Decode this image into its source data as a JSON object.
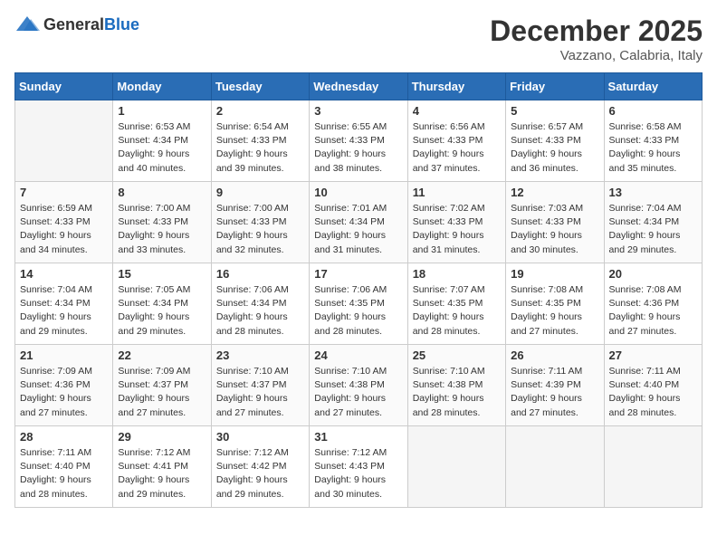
{
  "header": {
    "logo_general": "General",
    "logo_blue": "Blue",
    "month": "December 2025",
    "location": "Vazzano, Calabria, Italy"
  },
  "days_of_week": [
    "Sunday",
    "Monday",
    "Tuesday",
    "Wednesday",
    "Thursday",
    "Friday",
    "Saturday"
  ],
  "weeks": [
    [
      {
        "day": "",
        "empty": true
      },
      {
        "day": "1",
        "sunrise": "6:53 AM",
        "sunset": "4:34 PM",
        "daylight": "9 hours and 40 minutes."
      },
      {
        "day": "2",
        "sunrise": "6:54 AM",
        "sunset": "4:33 PM",
        "daylight": "9 hours and 39 minutes."
      },
      {
        "day": "3",
        "sunrise": "6:55 AM",
        "sunset": "4:33 PM",
        "daylight": "9 hours and 38 minutes."
      },
      {
        "day": "4",
        "sunrise": "6:56 AM",
        "sunset": "4:33 PM",
        "daylight": "9 hours and 37 minutes."
      },
      {
        "day": "5",
        "sunrise": "6:57 AM",
        "sunset": "4:33 PM",
        "daylight": "9 hours and 36 minutes."
      },
      {
        "day": "6",
        "sunrise": "6:58 AM",
        "sunset": "4:33 PM",
        "daylight": "9 hours and 35 minutes."
      }
    ],
    [
      {
        "day": "7",
        "sunrise": "6:59 AM",
        "sunset": "4:33 PM",
        "daylight": "9 hours and 34 minutes."
      },
      {
        "day": "8",
        "sunrise": "7:00 AM",
        "sunset": "4:33 PM",
        "daylight": "9 hours and 33 minutes."
      },
      {
        "day": "9",
        "sunrise": "7:00 AM",
        "sunset": "4:33 PM",
        "daylight": "9 hours and 32 minutes."
      },
      {
        "day": "10",
        "sunrise": "7:01 AM",
        "sunset": "4:34 PM",
        "daylight": "9 hours and 31 minutes."
      },
      {
        "day": "11",
        "sunrise": "7:02 AM",
        "sunset": "4:33 PM",
        "daylight": "9 hours and 31 minutes."
      },
      {
        "day": "12",
        "sunrise": "7:03 AM",
        "sunset": "4:33 PM",
        "daylight": "9 hours and 30 minutes."
      },
      {
        "day": "13",
        "sunrise": "7:04 AM",
        "sunset": "4:34 PM",
        "daylight": "9 hours and 29 minutes."
      }
    ],
    [
      {
        "day": "14",
        "sunrise": "7:04 AM",
        "sunset": "4:34 PM",
        "daylight": "9 hours and 29 minutes."
      },
      {
        "day": "15",
        "sunrise": "7:05 AM",
        "sunset": "4:34 PM",
        "daylight": "9 hours and 29 minutes."
      },
      {
        "day": "16",
        "sunrise": "7:06 AM",
        "sunset": "4:34 PM",
        "daylight": "9 hours and 28 minutes."
      },
      {
        "day": "17",
        "sunrise": "7:06 AM",
        "sunset": "4:35 PM",
        "daylight": "9 hours and 28 minutes."
      },
      {
        "day": "18",
        "sunrise": "7:07 AM",
        "sunset": "4:35 PM",
        "daylight": "9 hours and 28 minutes."
      },
      {
        "day": "19",
        "sunrise": "7:08 AM",
        "sunset": "4:35 PM",
        "daylight": "9 hours and 27 minutes."
      },
      {
        "day": "20",
        "sunrise": "7:08 AM",
        "sunset": "4:36 PM",
        "daylight": "9 hours and 27 minutes."
      }
    ],
    [
      {
        "day": "21",
        "sunrise": "7:09 AM",
        "sunset": "4:36 PM",
        "daylight": "9 hours and 27 minutes."
      },
      {
        "day": "22",
        "sunrise": "7:09 AM",
        "sunset": "4:37 PM",
        "daylight": "9 hours and 27 minutes."
      },
      {
        "day": "23",
        "sunrise": "7:10 AM",
        "sunset": "4:37 PM",
        "daylight": "9 hours and 27 minutes."
      },
      {
        "day": "24",
        "sunrise": "7:10 AM",
        "sunset": "4:38 PM",
        "daylight": "9 hours and 27 minutes."
      },
      {
        "day": "25",
        "sunrise": "7:10 AM",
        "sunset": "4:38 PM",
        "daylight": "9 hours and 28 minutes."
      },
      {
        "day": "26",
        "sunrise": "7:11 AM",
        "sunset": "4:39 PM",
        "daylight": "9 hours and 27 minutes."
      },
      {
        "day": "27",
        "sunrise": "7:11 AM",
        "sunset": "4:40 PM",
        "daylight": "9 hours and 28 minutes."
      }
    ],
    [
      {
        "day": "28",
        "sunrise": "7:11 AM",
        "sunset": "4:40 PM",
        "daylight": "9 hours and 28 minutes."
      },
      {
        "day": "29",
        "sunrise": "7:12 AM",
        "sunset": "4:41 PM",
        "daylight": "9 hours and 29 minutes."
      },
      {
        "day": "30",
        "sunrise": "7:12 AM",
        "sunset": "4:42 PM",
        "daylight": "9 hours and 29 minutes."
      },
      {
        "day": "31",
        "sunrise": "7:12 AM",
        "sunset": "4:43 PM",
        "daylight": "9 hours and 30 minutes."
      },
      {
        "day": "",
        "empty": true
      },
      {
        "day": "",
        "empty": true
      },
      {
        "day": "",
        "empty": true
      }
    ]
  ]
}
